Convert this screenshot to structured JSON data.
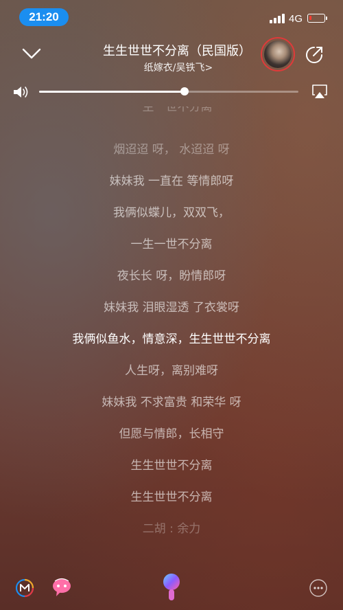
{
  "status_bar": {
    "time": "21:20",
    "network": "4G",
    "battery_level": 0.15,
    "battery_color": "#ff3b30",
    "time_pill_color": "#1b8ef0"
  },
  "header": {
    "collapse_icon": "chevron-down-icon",
    "title": "生生世世不分离（民国版）",
    "artist_line": "纸嫁衣/吴铁飞>",
    "avatar_ring_color": "#e03a3a",
    "share_icon": "share-icon"
  },
  "volume": {
    "level": 0.56,
    "speaker_icon": "speaker-icon",
    "airplay_icon": "airplay-icon"
  },
  "lyrics": {
    "lines": [
      {
        "text": "一生一世不分离",
        "state": "faded"
      },
      {
        "text": "烟迢迢 呀， 水迢迢 呀",
        "state": "dim"
      },
      {
        "text": "妹妹我 一直在 等情郎呀",
        "state": "normal"
      },
      {
        "text": "我俩似蝶儿，双双飞，",
        "state": "normal"
      },
      {
        "text": "一生一世不分离",
        "state": "normal"
      },
      {
        "text": "夜长长 呀，盼情郎呀",
        "state": "normal"
      },
      {
        "text": "妹妹我 泪眼湿透 了衣裳呀",
        "state": "normal"
      },
      {
        "text": "我俩似鱼水，情意深，生生世世不分离",
        "state": "active"
      },
      {
        "text": "人生呀，离别难呀",
        "state": "normal"
      },
      {
        "text": "妹妹我 不求富贵 和荣华 呀",
        "state": "normal"
      },
      {
        "text": "但愿与情郎，长相守",
        "state": "normal"
      },
      {
        "text": "生生世世不分离",
        "state": "normal"
      },
      {
        "text": "生生世世不分离",
        "state": "normal"
      },
      {
        "text": "二胡 : 余力",
        "state": "faded"
      }
    ]
  },
  "bottom_bar": {
    "icons": [
      "m-logo-icon",
      "chat-bubble-icon",
      "microphone-icon",
      "more-icon"
    ]
  }
}
